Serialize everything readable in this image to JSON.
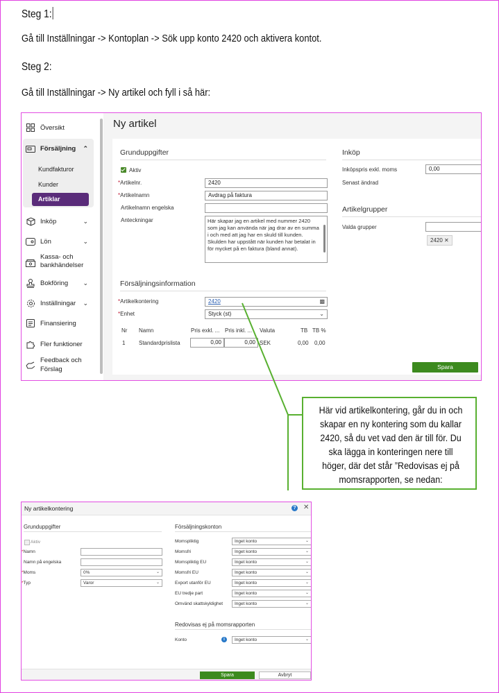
{
  "doc": {
    "step1_heading": "Steg 1:",
    "step1_text": "Gå till Inställningar -> Kontoplan -> Sök upp konto 2420 och aktivera kontot.",
    "step2_heading": "Steg 2:",
    "step2_text": "Gå till Inställningar -> Ny artikel och fyll i så här:"
  },
  "shot1": {
    "sidebar": {
      "items": [
        {
          "label": "Översikt",
          "icon": "grid-icon"
        },
        {
          "label": "Försäljning",
          "icon": "wallet-icon"
        },
        {
          "label": "Inköp",
          "icon": "box-icon"
        },
        {
          "label": "Lön",
          "icon": "card-icon"
        },
        {
          "label": "Kassa- och",
          "label2": "bankhändelser",
          "icon": "cash-icon"
        },
        {
          "label": "Bokföring",
          "icon": "stamp-icon"
        },
        {
          "label": "Inställningar",
          "icon": "gear-icon"
        },
        {
          "label": "Finansiering",
          "icon": "document-icon"
        },
        {
          "label": "Fler funktioner",
          "icon": "puzzle-icon"
        },
        {
          "label": "Feedback och",
          "label2": "Förslag",
          "icon": "hand-icon"
        }
      ],
      "sub_items": [
        "Kundfakturor",
        "Kunder",
        "Artiklar"
      ]
    },
    "title": "Ny artikel",
    "grund": {
      "title": "Grunduppgifter",
      "aktiv": "Aktiv",
      "artikelnr_label": "Artikelnr.",
      "artikelnr_value": "2420",
      "artikelnamn_label": "Artikelnamn",
      "artikelnamn_value": "Avdrag på faktura",
      "engelska_label": "Artikelnamn engelska",
      "anteckningar_label": "Anteckningar",
      "anteckningar_value": "Här skapar jag en artikel med nummer 2420 som jag kan använda när jag drar av en summa i och med att jag har en skuld till kunden. Skulden har uppstått när kunden har betalat in för mycket på en faktura (bland annat)."
    },
    "forsaljning": {
      "title": "Försäljningsinformation",
      "kontering_label": "Artikelkontering",
      "kontering_value": "2420",
      "enhet_label": "Enhet",
      "enhet_value": "Styck (st)",
      "columns": [
        "Nr",
        "Namn",
        "Pris exkl. ...",
        "Pris inkl. ...",
        "Valuta",
        "TB",
        "TB %"
      ],
      "row": [
        "1",
        "Standardprislista",
        "0,00",
        "0,00",
        "SEK",
        "0,00",
        "0,00"
      ]
    },
    "inkop": {
      "title": "Inköp",
      "pris_label": "Inköpspris exkl. moms",
      "pris_value": "0,00",
      "andrad_label": "Senast ändrad"
    },
    "grupper": {
      "title": "Artikelgrupper",
      "valda_label": "Valda grupper",
      "tag": "2420"
    },
    "save": "Spara"
  },
  "callout": {
    "text": "Här vid artikelkontering, går du in och skapar en ny kontering som du kallar 2420, så du vet vad den är till för. Du ska lägga in konteringen nere till höger, där det står ”Redovisas ej på momsrapporten, se nedan:"
  },
  "shot2": {
    "title": "Ny artikelkontering",
    "grund": {
      "title": "Grunduppgifter",
      "aktiv": "Aktiv",
      "namn": "Namn",
      "namn_eng": "Namn på engelska",
      "moms": "Moms",
      "moms_value": "0%",
      "typ": "Typ",
      "typ_value": "Varor"
    },
    "konton": {
      "title": "Försäljningskonton",
      "rows": [
        {
          "label": "Momspliktig",
          "value": "Inget konto"
        },
        {
          "label": "Momsfri",
          "value": "Inget konto"
        },
        {
          "label": "Momspliktig EU",
          "value": "Inget konto"
        },
        {
          "label": "Momsfri EU",
          "value": "Inget konto"
        },
        {
          "label": "Export utanför EU",
          "value": "Inget konto"
        },
        {
          "label": "EU tredje part",
          "value": "Inget konto"
        },
        {
          "label": "Omvänd skattskyldighet",
          "value": "Inget konto"
        }
      ]
    },
    "redovisas": {
      "title": "Redovisas ej på momsrapporten",
      "konto_label": "Konto",
      "konto_value": "Inget konto"
    },
    "save": "Spara",
    "cancel": "Avbryt"
  },
  "colors": {
    "accent_purple": "#5a2c7a",
    "accent_green": "#3c8a1e",
    "callout_border": "#58b030",
    "frame": "#e24ce2"
  }
}
